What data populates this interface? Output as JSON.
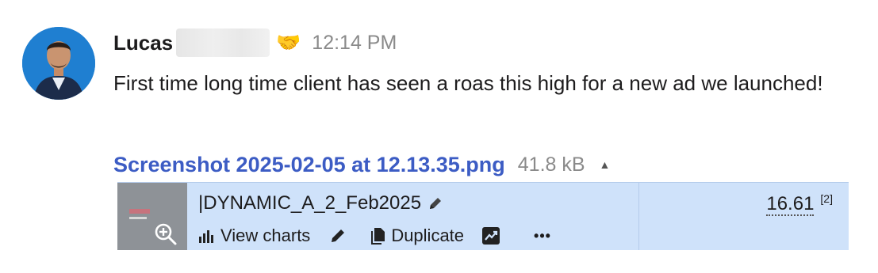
{
  "message": {
    "author": "Lucas",
    "reaction_emoji": "🤝",
    "time": "12:14 PM",
    "text": "First time long time client has seen a roas this high for a new ad we launched!"
  },
  "attachment": {
    "file_name": "Screenshot 2025-02-05 at 12.13.35.png",
    "file_size": "41.8 kB",
    "toggle_icon": "caret-up-icon"
  },
  "preview": {
    "ad_name": "|DYNAMIC_A_2_Feb2025",
    "actions": {
      "view_charts": "View charts",
      "duplicate": "Duplicate",
      "more": "•••"
    },
    "roas_value": "16.61",
    "roas_ref": "[2]"
  },
  "colors": {
    "link": "#3c5cc4",
    "muted": "#8a8a8a",
    "preview_bg": "#cfe2fa",
    "avatar_bg": "#1f7fd1"
  }
}
